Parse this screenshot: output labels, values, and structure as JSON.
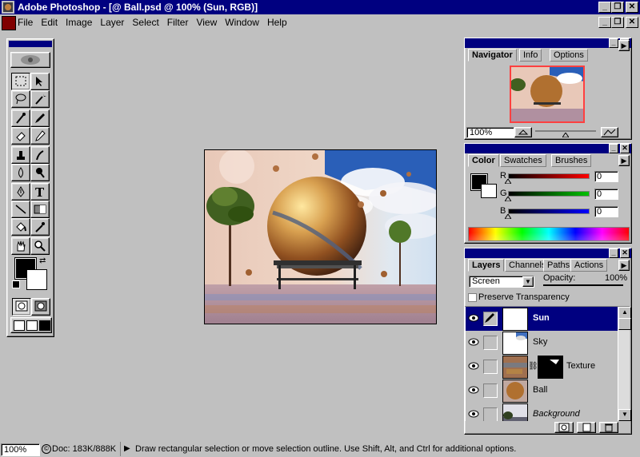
{
  "window": {
    "title": "Adobe Photoshop - [@ Ball.psd @ 100% (Sun, RGB)]",
    "min_glyph": "_",
    "max_glyph": "❐",
    "close_glyph": "✕"
  },
  "menu": [
    "File",
    "Edit",
    "Image",
    "Layer",
    "Select",
    "Filter",
    "View",
    "Window",
    "Help"
  ],
  "toolbox": {
    "tools": [
      "marquee",
      "move",
      "lasso",
      "magic-wand",
      "airbrush",
      "paintbrush",
      "eraser",
      "pencil",
      "rubber-stamp",
      "smudge",
      "blur",
      "dodge",
      "pen",
      "type",
      "line",
      "gradient",
      "paint-bucket",
      "eyedropper",
      "hand",
      "zoom"
    ],
    "foreground_color": "#000000",
    "background_color": "#ffffff"
  },
  "navigator": {
    "tabs": [
      "Navigator",
      "Info",
      "Options"
    ],
    "active_tab": "Navigator",
    "zoom_value": "100%",
    "zoom_slider": 0.5,
    "view_box_color": "#ff4040"
  },
  "color_palette": {
    "tabs": [
      "Color",
      "Swatches",
      "Brushes"
    ],
    "active_tab": "Color",
    "channels": [
      {
        "label": "R",
        "value": "0",
        "color": "#ff0000"
      },
      {
        "label": "G",
        "value": "0",
        "color": "#00c000"
      },
      {
        "label": "B",
        "value": "0",
        "color": "#0000ff"
      }
    ]
  },
  "layers_palette": {
    "tabs": [
      "Layers",
      "Channels",
      "Paths",
      "Actions"
    ],
    "active_tab": "Layers",
    "blend_mode": "Screen",
    "opacity_label": "Opacity:",
    "opacity_value": "100%",
    "preserve_transparency": "Preserve Transparency",
    "layers": [
      {
        "name": "Sun",
        "selected": true,
        "mask": false,
        "italic": false
      },
      {
        "name": "Sky",
        "selected": false,
        "mask": false,
        "italic": false
      },
      {
        "name": "Texture",
        "selected": false,
        "mask": true,
        "italic": false
      },
      {
        "name": "Ball",
        "selected": false,
        "mask": false,
        "italic": false
      },
      {
        "name": "Background",
        "selected": false,
        "mask": false,
        "italic": true
      }
    ]
  },
  "status": {
    "zoom": "100%",
    "doc": "Doc: 183K/888K",
    "hint": "Draw rectangular selection or move selection outline.  Use Shift, Alt, and Ctrl for additional options."
  }
}
